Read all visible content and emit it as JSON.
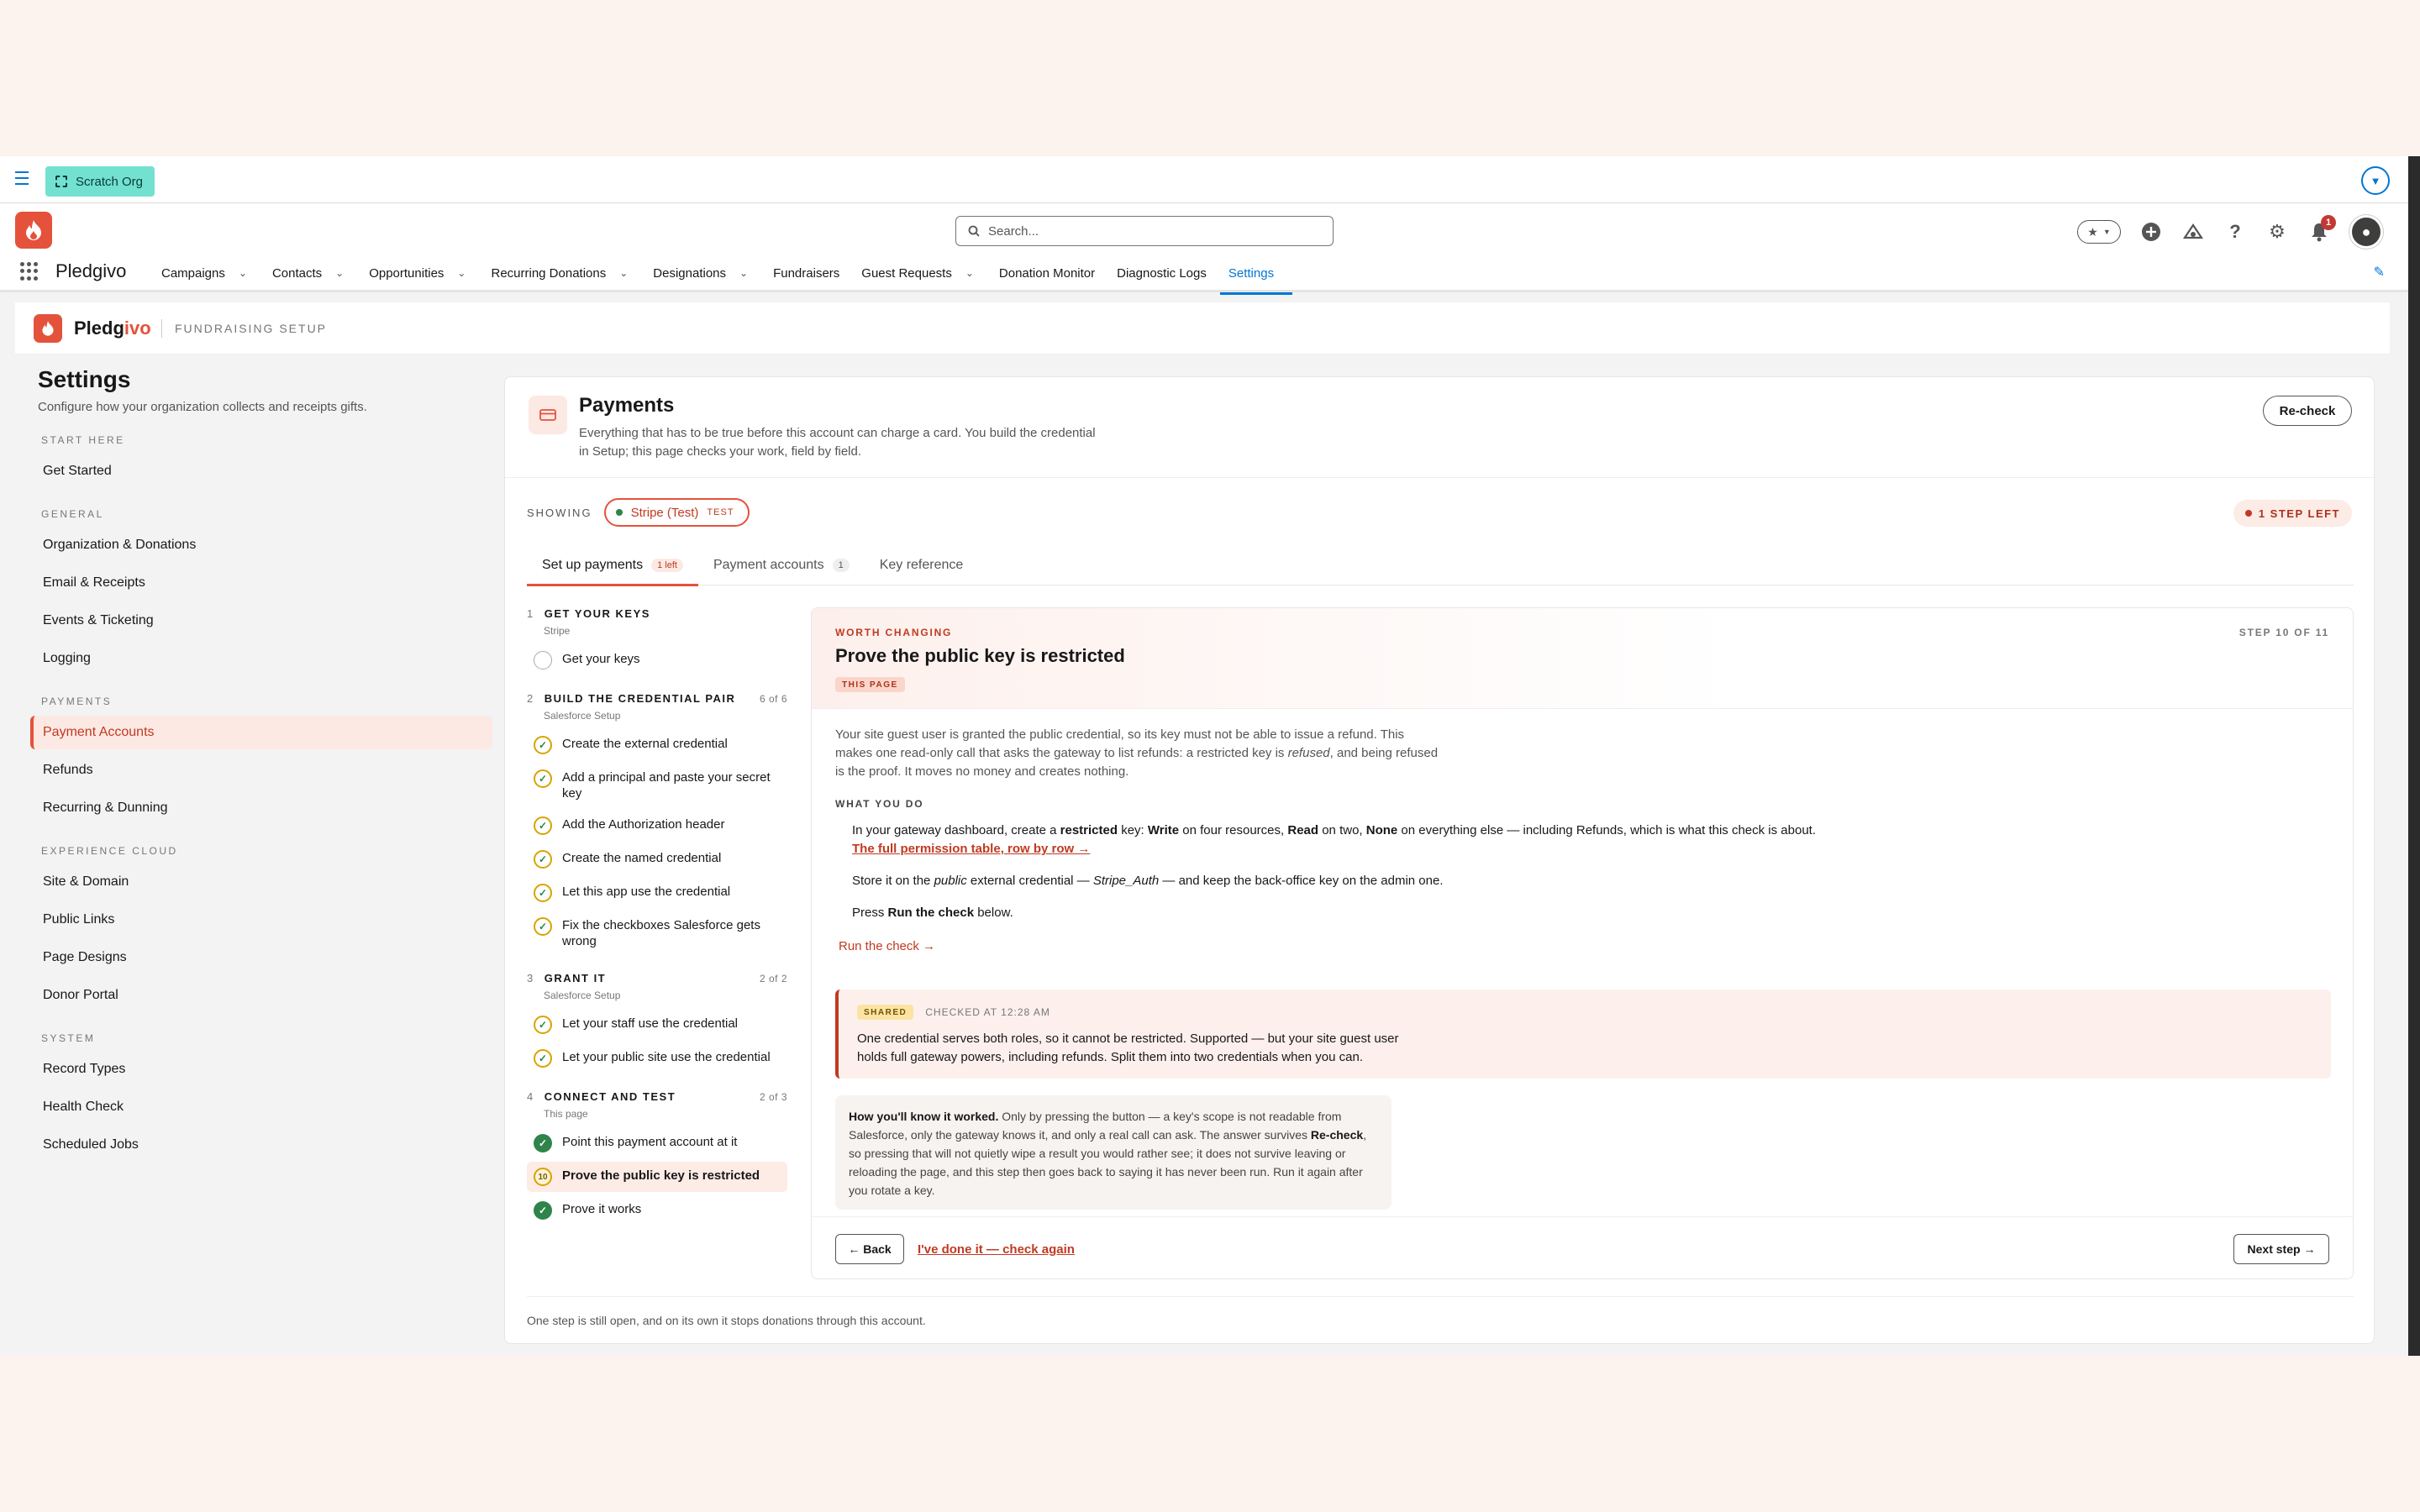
{
  "topbar": {
    "org_label": "Scratch Org"
  },
  "header": {
    "search_placeholder": "Search...",
    "notification_count": "1"
  },
  "nav": {
    "app_name": "Pledgivo",
    "items": [
      {
        "label": "Campaigns",
        "dropdown": true
      },
      {
        "label": "Contacts",
        "dropdown": true
      },
      {
        "label": "Opportunities",
        "dropdown": true
      },
      {
        "label": "Recurring Donations",
        "dropdown": true
      },
      {
        "label": "Designations",
        "dropdown": true
      },
      {
        "label": "Fundraisers",
        "dropdown": false
      },
      {
        "label": "Guest Requests",
        "dropdown": true
      },
      {
        "label": "Donation Monitor",
        "dropdown": false
      },
      {
        "label": "Diagnostic Logs",
        "dropdown": false
      },
      {
        "label": "Settings",
        "dropdown": false,
        "active": true
      }
    ]
  },
  "brand": {
    "name_a": "Pledg",
    "name_b": "ivo",
    "subtitle": "FUNDRAISING SETUP"
  },
  "sidebar": {
    "title": "Settings",
    "subtitle": "Configure how your organization collects and receipts gifts.",
    "groups": [
      {
        "label": "START HERE",
        "items": [
          {
            "label": "Get Started"
          }
        ]
      },
      {
        "label": "GENERAL",
        "items": [
          {
            "label": "Organization & Donations"
          },
          {
            "label": "Email & Receipts"
          },
          {
            "label": "Events & Ticketing"
          },
          {
            "label": "Logging"
          }
        ]
      },
      {
        "label": "PAYMENTS",
        "items": [
          {
            "label": "Payment Accounts",
            "active": true
          },
          {
            "label": "Refunds"
          },
          {
            "label": "Recurring & Dunning"
          }
        ]
      },
      {
        "label": "EXPERIENCE CLOUD",
        "items": [
          {
            "label": "Site & Domain"
          },
          {
            "label": "Public Links"
          },
          {
            "label": "Page Designs"
          },
          {
            "label": "Donor Portal"
          }
        ]
      },
      {
        "label": "SYSTEM",
        "items": [
          {
            "label": "Record Types"
          },
          {
            "label": "Health Check"
          },
          {
            "label": "Scheduled Jobs"
          }
        ]
      }
    ]
  },
  "payments": {
    "title": "Payments",
    "description": "Everything that has to be true before this account can charge a card. You build the credential in Setup; this page checks your work, field by field.",
    "recheck_label": "Re-check",
    "showing_label": "SHOWING",
    "account_chip": "Stripe (Test)",
    "account_chip_tag": "TEST",
    "steps_left": "1 STEP LEFT",
    "tabs": [
      {
        "label": "Set up payments",
        "count": "1 left",
        "active": true
      },
      {
        "label": "Payment accounts",
        "count": "1"
      },
      {
        "label": "Key reference",
        "count": ""
      }
    ]
  },
  "steps": [
    {
      "num": "1",
      "title": "GET YOUR KEYS",
      "progress": "",
      "sub": "Stripe",
      "items": [
        {
          "label": "Get your keys",
          "state": "todo"
        }
      ]
    },
    {
      "num": "2",
      "title": "BUILD THE CREDENTIAL PAIR",
      "progress": "6 of 6",
      "sub": "Salesforce Setup",
      "items": [
        {
          "label": "Create the external credential",
          "state": "warn"
        },
        {
          "label": "Add a principal and paste your secret key",
          "state": "warn"
        },
        {
          "label": "Add the Authorization header",
          "state": "warn"
        },
        {
          "label": "Create the named credential",
          "state": "warn"
        },
        {
          "label": "Let this app use the credential",
          "state": "warn"
        },
        {
          "label": "Fix the checkboxes Salesforce gets wrong",
          "state": "warn"
        }
      ]
    },
    {
      "num": "3",
      "title": "GRANT IT",
      "progress": "2 of 2",
      "sub": "Salesforce Setup",
      "items": [
        {
          "label": "Let your staff use the credential",
          "state": "warn"
        },
        {
          "label": "Let your public site use the credential",
          "state": "warn"
        }
      ]
    },
    {
      "num": "4",
      "title": "CONNECT AND TEST",
      "progress": "2 of 3",
      "sub": "This page",
      "items": [
        {
          "label": "Point this payment account at it",
          "state": "done"
        },
        {
          "label": "Prove the public key is restricted",
          "state": "current",
          "badge": "10"
        },
        {
          "label": "Prove it works",
          "state": "done"
        }
      ]
    }
  ],
  "detail": {
    "kicker": "WORTH CHANGING",
    "step_counter": "STEP 10 OF 11",
    "title": "Prove the public key is restricted",
    "tag": "THIS PAGE",
    "lead_1": "Your site guest user is granted the public credential, so its key must not be able to issue a refund. This makes one read-only call that asks the gateway to list refunds: a restricted key is ",
    "lead_em": "refused",
    "lead_2": ", and being refused is the proof. It moves no money and creates nothing.",
    "what_you_do": "WHAT YOU DO",
    "li1_a": "In your gateway dashboard, create a ",
    "li1_b": "restricted",
    "li1_c": " key: ",
    "li1_d": "Write",
    "li1_e": " on four resources, ",
    "li1_f": "Read",
    "li1_g": " on two, ",
    "li1_h": "None",
    "li1_i": " on everything else — including Refunds, which is what this check is about.",
    "li1_link": "The full permission table, row by row →",
    "li2_a": "Store it on the ",
    "li2_b": "public",
    "li2_c": " external credential — ",
    "li2_d": "Stripe_Auth",
    "li2_e": " — and keep the back-office key on the admin one.",
    "li3_a": "Press ",
    "li3_b": "Run the check",
    "li3_c": " below.",
    "run_link": "Run the check →",
    "shared_tag": "SHARED",
    "shared_time": "CHECKED AT 12:28 AM",
    "shared_text": "One credential serves both roles, so it cannot be restricted. Supported — but your site guest user holds full gateway powers, including refunds. Split them into two credentials when you can.",
    "how_bold": "How you'll know it worked.",
    "how_1": " Only by pressing the button — a key's scope is not readable from Salesforce, only the gateway knows it, and only a real call can ask. The answer survives ",
    "how_bold2": "Re-check",
    "how_2": ", so pressing that will not quietly wipe a result you would rather see; it does not survive leaving or reloading the page, and this step then goes back to saying it has never been run. Run it again after you rotate a key.",
    "back_label": "← Back",
    "again_label": "I've done it — check again",
    "next_label": "Next step →"
  },
  "footer_note": "One step is still open, and on its own it stops donations through this account.",
  "colors": {
    "brand": "#e4523b",
    "link": "#0176d3",
    "success": "#2e844a"
  }
}
